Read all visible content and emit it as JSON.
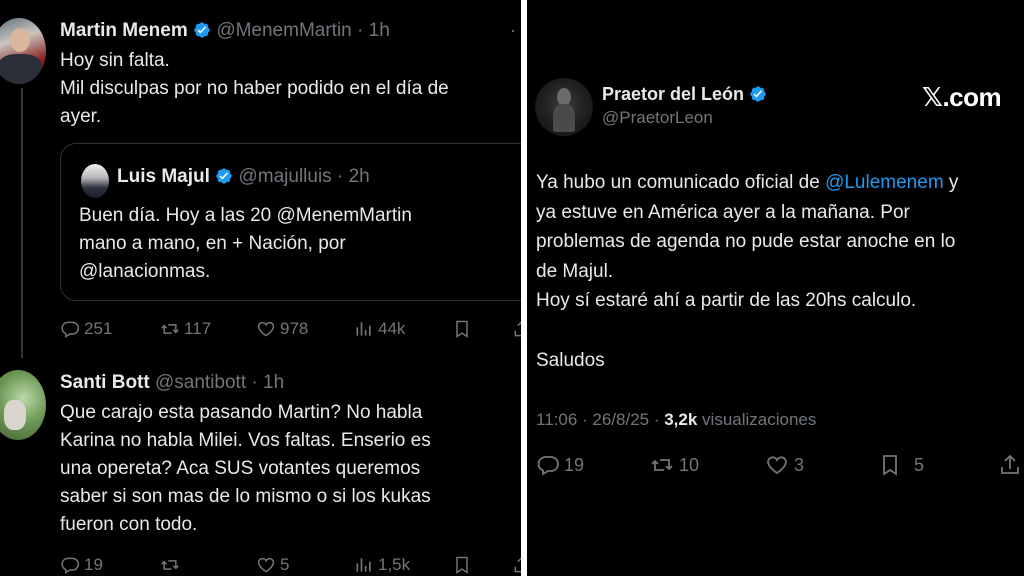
{
  "left": {
    "menem_tweet": {
      "name": "Martin Menem",
      "handle": "@MenemMartin",
      "time": "1h",
      "lines": [
        "Hoy sin falta.",
        "Mil disculpas por no haber podido en el día de",
        "ayer."
      ],
      "quote": {
        "name": "Luis Majul",
        "handle": "@majulluis",
        "time": "2h",
        "lines": [
          "Buen día. Hoy a las 20 @MenemMartin",
          "mano a mano, en + Nación, por",
          "@lanacionmas."
        ]
      },
      "actions": {
        "replies": "251",
        "reposts": "117",
        "likes": "978",
        "views": "44k"
      }
    },
    "bott_tweet": {
      "name": "Santi Bott",
      "handle": "@santibott",
      "time": "1h",
      "lines": [
        "Que carajo esta pasando Martin? No habla",
        "Karina no habla Milei. Vos faltas. Enserio es",
        "una opereta? Aca SUS votantes queremos",
        "saber si son mas de lo mismo o si los kukas",
        "fueron con todo."
      ],
      "actions": {
        "replies": "19",
        "likes": "5",
        "views": "1,5k"
      }
    }
  },
  "right": {
    "name": "Praetor del León",
    "handle": "@PraetorLeon",
    "brand": "𝕏.com",
    "text": {
      "p1a": "Ya hubo un comunicado oficial de ",
      "mention": "@Lulemenem",
      "p1b": " y",
      "l2": "ya estuve en América ayer a la mañana. Por",
      "l3": "problemas de agenda no pude estar anoche en lo",
      "l4": "de Majul.",
      "l5": "Hoy sí estaré ahí a partir de las 20hs calculo.",
      "l6": "Saludos"
    },
    "meta": {
      "time": "11:06 · 26/8/25 · ",
      "views_count": "3,2k",
      "views_label": " visualizaciones"
    },
    "actions": {
      "replies": "19",
      "reposts": "10",
      "likes": "3",
      "bookmarks": "5"
    }
  },
  "colors": {
    "background": "#000000",
    "text": "#e7e9ea",
    "muted": "#71767b",
    "link": "#1d9bf0",
    "verified": "#1d9bf0"
  }
}
